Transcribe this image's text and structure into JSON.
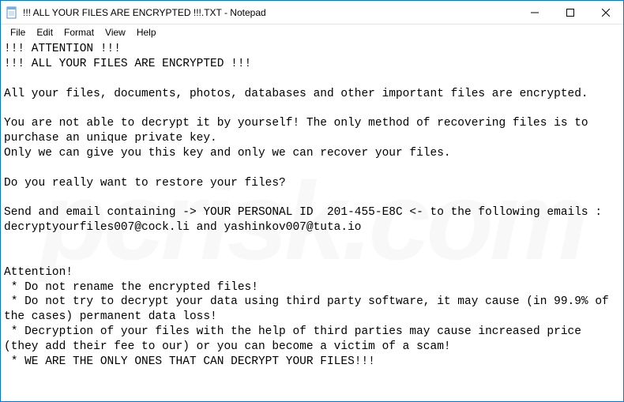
{
  "window": {
    "title": "!!! ALL YOUR FILES ARE ENCRYPTED !!!.TXT - Notepad"
  },
  "menubar": {
    "items": [
      "File",
      "Edit",
      "Format",
      "View",
      "Help"
    ]
  },
  "document": {
    "content": "!!! ATTENTION !!!\n!!! ALL YOUR FILES ARE ENCRYPTED !!!\n\nAll your files, documents, photos, databases and other important files are encrypted.\n\nYou are not able to decrypt it by yourself! The only method of recovering files is to purchase an unique private key.\nOnly we can give you this key and only we can recover your files.\n\nDo you really want to restore your files?\n\nSend and email containing -> YOUR PERSONAL ID  201-455-E8C <- to the following emails : decryptyourfiles007@cock.li and yashinkov007@tuta.io\n\n\nAttention!\n * Do not rename the encrypted files!\n * Do not try to decrypt your data using third party software, it may cause (in 99.9% of the cases) permanent data loss!\n * Decryption of your files with the help of third parties may cause increased price (they add their fee to our) or you can become a victim of a scam!\n * WE ARE THE ONLY ONES THAT CAN DECRYPT YOUR FILES!!!"
  },
  "watermark": "pcrisk.com"
}
